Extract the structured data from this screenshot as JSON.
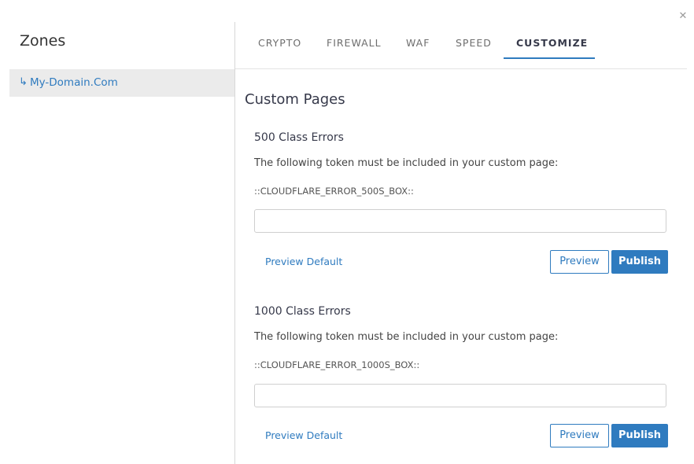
{
  "dialog": {
    "close_icon": "close-icon"
  },
  "sidebar": {
    "title": "Zones",
    "items": [
      {
        "arrow": "↳",
        "label": "My-Domain.Com"
      }
    ]
  },
  "tabs": [
    {
      "label": "CRYPTO",
      "active": false
    },
    {
      "label": "FIREWALL",
      "active": false
    },
    {
      "label": "WAF",
      "active": false
    },
    {
      "label": "SPEED",
      "active": false
    },
    {
      "label": "CUSTOMIZE",
      "active": true
    }
  ],
  "main": {
    "heading": "Custom Pages",
    "sections": [
      {
        "title": "500 Class Errors",
        "description": "The following token must be included in your custom page:",
        "token": "::CLOUDFLARE_ERROR_500S_BOX::",
        "input_value": "",
        "preview_default_label": "Preview Default",
        "preview_label": "Preview",
        "publish_label": "Publish"
      },
      {
        "title": "1000 Class Errors",
        "description": "The following token must be included in your custom page:",
        "token": "::CLOUDFLARE_ERROR_1000S_BOX::",
        "input_value": "",
        "preview_default_label": "Preview Default",
        "preview_label": "Preview",
        "publish_label": "Publish"
      }
    ]
  },
  "colors": {
    "accent": "#2f7bbf",
    "selected_background": "#ebebeb",
    "divider": "#d7d7d7"
  }
}
